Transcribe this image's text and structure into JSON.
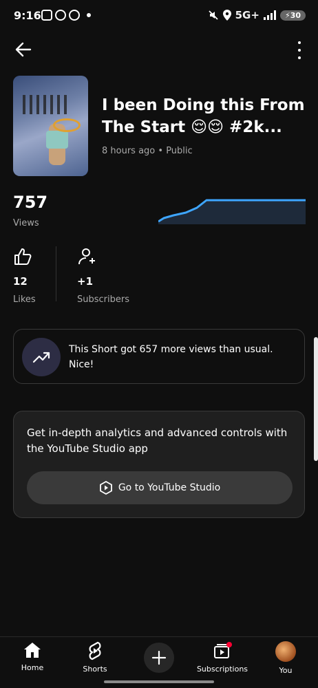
{
  "status_bar": {
    "time": "9:16",
    "network": "5G+",
    "battery": "30"
  },
  "video": {
    "title": "I been Doing this From The Start 😌😌 #2k...",
    "meta": "8 hours ago • Public"
  },
  "views": {
    "count": "757",
    "label": "Views"
  },
  "stats": {
    "likes": {
      "count": "12",
      "label": "Likes"
    },
    "subscribers": {
      "count": "+1",
      "label": "Subscribers"
    }
  },
  "insight": {
    "text": "This Short got 657 more views than usual. Nice!"
  },
  "studio_card": {
    "text": "Get in-depth analytics and advanced controls with the YouTube Studio app",
    "button_label": "Go to YouTube Studio"
  },
  "bottom_nav": {
    "home": "Home",
    "shorts": "Shorts",
    "subscriptions": "Subscriptions",
    "you": "You"
  },
  "colors": {
    "accent": "#3ea6ff",
    "background": "#0f0f0f",
    "notification": "#ff0033"
  }
}
